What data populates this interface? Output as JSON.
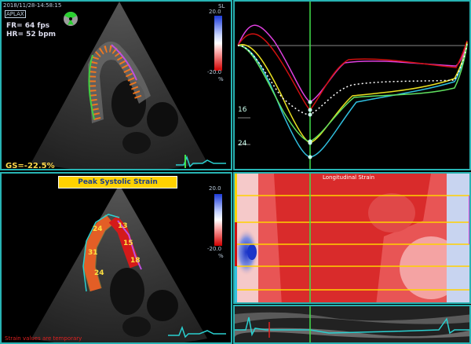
{
  "top_view": {
    "timestamp": "2018/11/28-14:58:15",
    "view_label": "APLAX",
    "frame_rate": "FR= 64 fps",
    "heart_rate": "HR= 52 bpm",
    "scale_title": "SL",
    "scale_max": "20.0",
    "scale_min": "-20.0",
    "scale_unit": "%",
    "global_strain": "GS=-22.5%"
  },
  "bottom_view": {
    "title_banner": "Peak Systolic Strain",
    "scale_max": "20.0",
    "scale_min": "-20.0",
    "scale_unit": "%",
    "segment_values": [
      "24",
      "31",
      "24",
      "13",
      "15",
      "18"
    ],
    "footer_note": "Strain values are temporary"
  },
  "strain_graph": {
    "y_ticks": [
      "16",
      "24"
    ]
  },
  "heatmap": {
    "title": "Longitudinal Strain"
  },
  "colors": {
    "panel_border": "#27b3b3",
    "banner_bg": "#ffd200",
    "banner_text": "#1d3f8a",
    "global_strain": "#ffd84a",
    "footer_note": "#e02020",
    "cursor": "#41e04a"
  }
}
